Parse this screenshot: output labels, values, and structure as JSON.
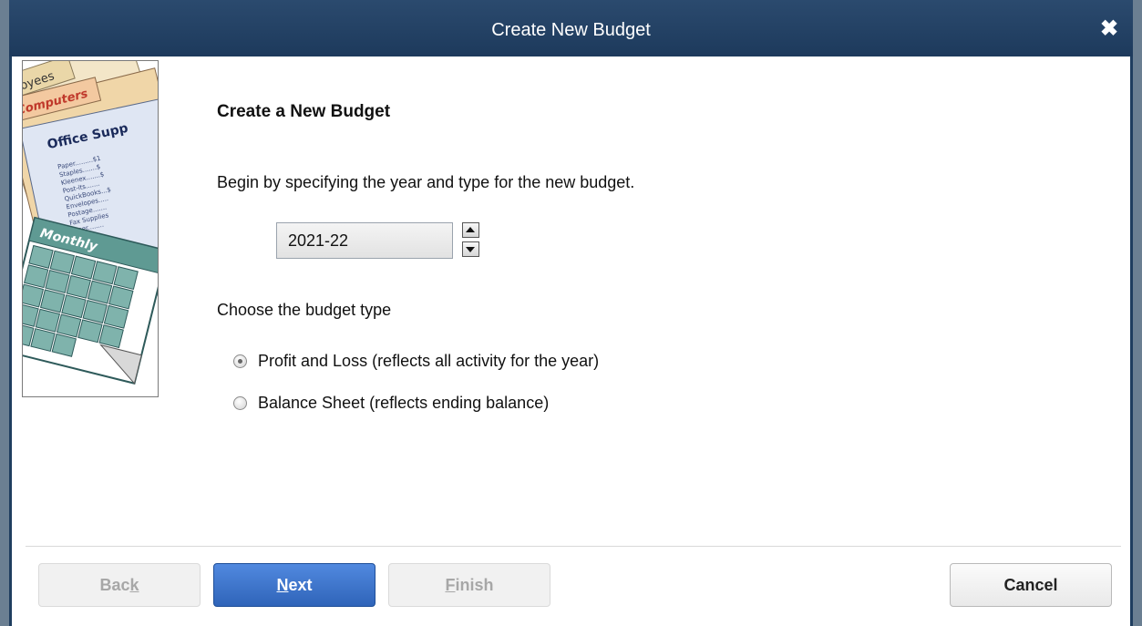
{
  "window": {
    "title": "Create New Budget",
    "close_label": "✖"
  },
  "illustration": {
    "tab_employees": "mployees",
    "tab_computers": "Computers",
    "tab_office": "Office Supp",
    "lines": [
      "Paper.........$1",
      "Staples.......$",
      "Kleenex.......$",
      "Post-its.......",
      "QuickBooks...$",
      "Envelopes.....",
      "Postage.......",
      "Fax Supplies",
      "Toner........"
    ],
    "calendar_label": "Monthly"
  },
  "content": {
    "heading": "Create a New Budget",
    "intro": "Begin by specifying the year and type for the new budget.",
    "year_value": "2021-22",
    "choose_label": "Choose the budget type",
    "options": [
      {
        "label": "Profit and Loss (reflects all activity for the year)",
        "checked": true
      },
      {
        "label": "Balance Sheet (reflects ending balance)",
        "checked": false
      }
    ]
  },
  "buttons": {
    "back": {
      "pre": "Bac",
      "key": "k",
      "post": ""
    },
    "next": {
      "pre": "",
      "key": "N",
      "post": "ext"
    },
    "finish": {
      "pre": "",
      "key": "F",
      "post": "inish"
    },
    "cancel": "Cancel"
  },
  "colors": {
    "titlebar": "#1f3d5f",
    "primary_button": "#3a70c8",
    "disabled_text": "#a7a7a7"
  }
}
